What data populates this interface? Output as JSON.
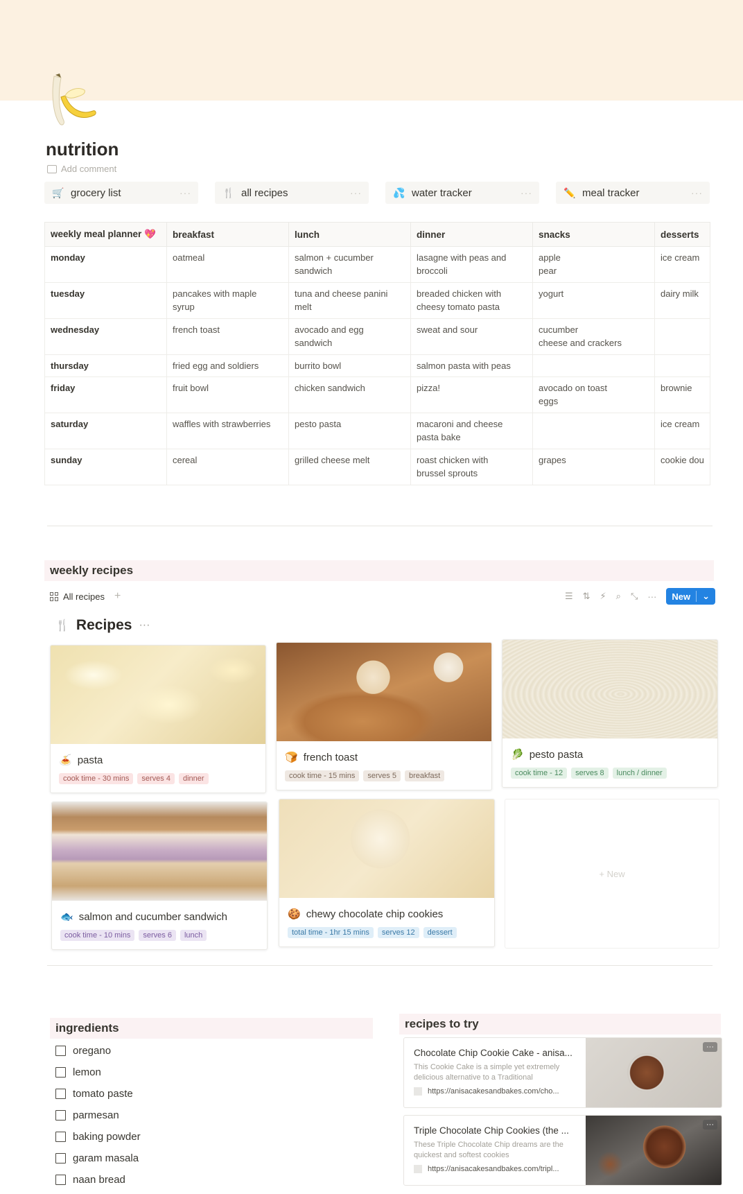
{
  "page": {
    "title": "nutrition",
    "add_comment": "Add comment",
    "icon": "banana-icon"
  },
  "quick_links": [
    {
      "label": "grocery list",
      "icon": "cart-icon",
      "glyph": "🛒"
    },
    {
      "label": "all recipes",
      "icon": "fork-knife-icon",
      "glyph": "🍴"
    },
    {
      "label": "water tracker",
      "icon": "droplets-icon",
      "glyph": "💦"
    },
    {
      "label": "meal tracker",
      "icon": "pencil-icon",
      "glyph": "✏️"
    }
  ],
  "planner": {
    "headers": [
      "weekly meal planner 💖",
      "breakfast",
      "lunch",
      "dinner",
      "snacks",
      "desserts"
    ],
    "rows": [
      [
        "monday",
        "oatmeal",
        "salmon + cucumber\nsandwich",
        "lasagne with peas and\nbroccoli",
        "apple\npear",
        "ice cream"
      ],
      [
        "tuesday",
        "pancakes with maple\nsyrup",
        "tuna and cheese panini\nmelt",
        "breaded chicken with\ncheesy tomato pasta",
        "yogurt",
        "dairy milk"
      ],
      [
        "wednesday",
        "french toast",
        "avocado and egg\nsandwich",
        "sweat and sour",
        "cucumber\ncheese and crackers",
        ""
      ],
      [
        "thursday",
        "fried egg and soldiers",
        "burrito bowl",
        "salmon pasta with peas",
        "",
        ""
      ],
      [
        "friday",
        "fruit bowl",
        "chicken sandwich",
        "pizza!",
        "avocado on toast\neggs",
        "brownie"
      ],
      [
        "saturday",
        "waffles with strawberries",
        "pesto pasta",
        "macaroni and cheese\npasta bake",
        "",
        "ice cream"
      ],
      [
        "sunday",
        "cereal",
        "grilled cheese melt",
        "roast chicken with\nbrussel sprouts",
        "grapes",
        "cookie dou"
      ]
    ]
  },
  "weekly_recipes": {
    "heading": "weekly recipes",
    "view_label": "All recipes",
    "new_label": "New",
    "db_title": "Recipes",
    "cards": [
      {
        "name": "pasta",
        "glyph": "🍝",
        "icon": "pasta-icon",
        "tags": [
          [
            "cook time - 30 mins",
            "red"
          ],
          [
            "serves 4",
            "red"
          ],
          [
            "dinner",
            "red"
          ]
        ]
      },
      {
        "name": "french toast",
        "glyph": "🍞",
        "icon": "bread-icon",
        "tags": [
          [
            "cook time - 15 mins",
            "brown"
          ],
          [
            "serves 5",
            "brown"
          ],
          [
            "breakfast",
            "brown"
          ]
        ]
      },
      {
        "name": "pesto pasta",
        "glyph": "🥬",
        "icon": "leafy-green-icon",
        "tags": [
          [
            "cook time - 12",
            "green"
          ],
          [
            "serves 8",
            "green"
          ],
          [
            "lunch / dinner",
            "green"
          ]
        ]
      },
      {
        "name": "salmon and cucumber sandwich",
        "glyph": "🐟",
        "icon": "fish-icon",
        "tags": [
          [
            "cook time - 10 mins",
            "purple"
          ],
          [
            "serves 6",
            "purple"
          ],
          [
            "lunch",
            "purple"
          ]
        ]
      },
      {
        "name": "chewy chocolate chip cookies",
        "glyph": "🍪",
        "icon": "cookie-icon",
        "tags": [
          [
            "total time - 1hr 15 mins",
            "blue"
          ],
          [
            "serves 12",
            "blue"
          ],
          [
            "dessert",
            "blue"
          ]
        ]
      }
    ],
    "empty_new": "+ New"
  },
  "ingredients": {
    "heading": "ingredients",
    "items": [
      "oregano",
      "lemon",
      "tomato paste",
      "parmesan",
      "baking powder",
      "garam masala",
      "naan bread"
    ]
  },
  "recipes_to_try": {
    "heading": "recipes to try",
    "bookmarks": [
      {
        "title": "Chocolate Chip Cookie Cake - anisa...",
        "desc": "This Cookie Cake is a simple yet extremely delicious alternative to a Traditional",
        "url": "https://anisacakesandbakes.com/cho..."
      },
      {
        "title": "Triple Chocolate Chip Cookies (the ...",
        "desc": "These Triple Chocolate Chip dreams are the quickest and softest cookies",
        "url": "https://anisacakesandbakes.com/tripl..."
      }
    ]
  },
  "colors": {
    "cover": "#fcf1e1",
    "accent_blue": "#2383e2",
    "section_header_bg": "#fbf2f3"
  }
}
